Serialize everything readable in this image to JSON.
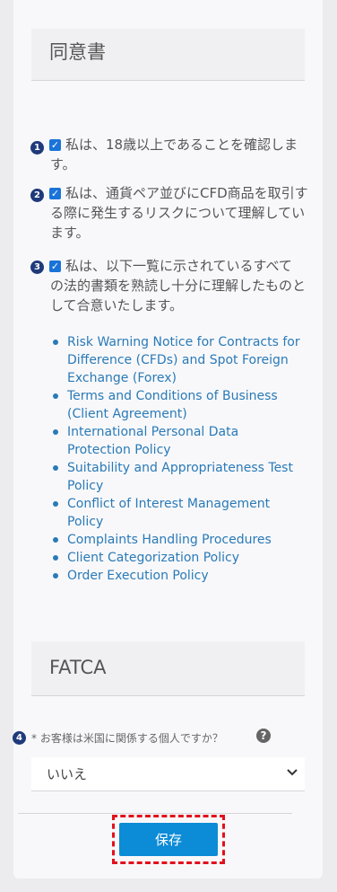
{
  "consent": {
    "title": "同意書",
    "items": [
      {
        "num": "1",
        "line1": "私は、18歳以上であることを確認しま",
        "line2": "す。",
        "line3": ""
      },
      {
        "num": "2",
        "line1": "私は、通貨ペア並びにCFD商品を取引す",
        "line2": "る際に発生するリスクについて理解してい",
        "line3": "ます。"
      },
      {
        "num": "3",
        "line1": "私は、以下一覧に示されているすべて",
        "line2": "の法的書類を熟読し十分に理解したものと",
        "line3": "して合意いたします。"
      }
    ],
    "documents": [
      {
        "l1": "Risk Warning Notice for Contracts for",
        "l2": "Difference (CFDs) and Spot Foreign",
        "l3": "Exchange (Forex)"
      },
      {
        "l1": "Terms and Conditions of Business",
        "l2": "(Client Agreement)",
        "l3": ""
      },
      {
        "l1": "International Personal Data",
        "l2": "Protection Policy",
        "l3": ""
      },
      {
        "l1": "Suitability and Appropriateness Test",
        "l2": "Policy",
        "l3": ""
      },
      {
        "l1": "Conflict of Interest Management",
        "l2": "Policy",
        "l3": ""
      },
      {
        "l1": "Complaints Handling Procedures",
        "l2": "",
        "l3": ""
      },
      {
        "l1": "Client Categorization Policy",
        "l2": "",
        "l3": ""
      },
      {
        "l1": "Order Execution Policy",
        "l2": "",
        "l3": ""
      }
    ]
  },
  "fatca": {
    "title": "FATCA",
    "num": "4",
    "question": "* お客様は米国に関係する個人ですか？",
    "help_icon": "?",
    "selected": "いいえ"
  },
  "save_label": "保存",
  "colors": {
    "badge": "#1f3a7a",
    "link": "#2a7ab7",
    "button": "#0c8bd6",
    "highlight": "#e2101c",
    "checkbox": "#1a73d8"
  }
}
